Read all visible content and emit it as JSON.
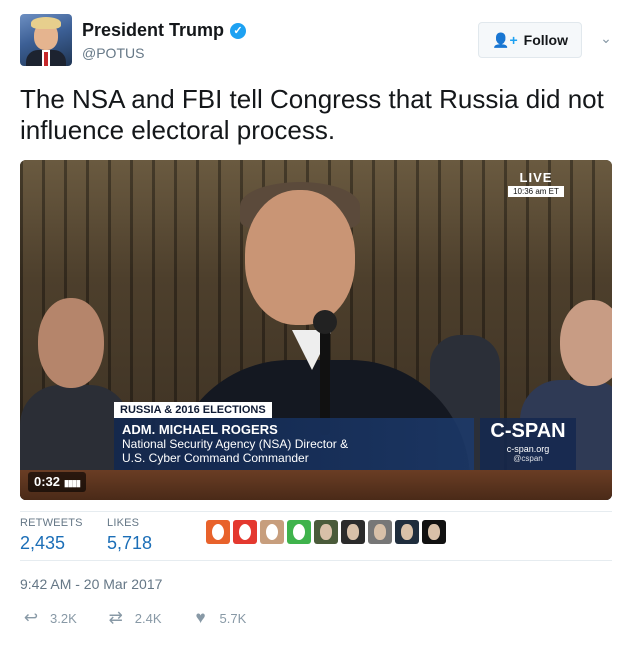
{
  "user": {
    "name": "President Trump",
    "handle": "@POTUS",
    "verified": true
  },
  "follow_button": {
    "label": "Follow",
    "icon": "add-user-icon"
  },
  "menu_icon": "chevron-down-icon",
  "tweet": {
    "text": "The NSA and FBI tell Congress that Russia did not influence electoral process."
  },
  "video": {
    "live_label": "LIVE",
    "live_time": "10:36 am ET",
    "chyron_tag": "RUSSIA & 2016 ELECTIONS",
    "chyron_name": "ADM. MICHAEL ROGERS",
    "chyron_title_1": "National Security Agency (NSA) Director &",
    "chyron_title_2": "U.S. Cyber Command Commander",
    "network_logo": "C-SPAN",
    "network_site": "c-span.org",
    "network_twitter": "@cspan",
    "timecode": "0:32"
  },
  "stats": {
    "retweets_label": "RETWEETS",
    "retweets_value": "2,435",
    "likes_label": "LIKES",
    "likes_value": "5,718"
  },
  "likers": [
    {
      "color": "#e8622b"
    },
    {
      "color": "#e4392f"
    },
    {
      "color": "#c79e7d"
    },
    {
      "color": "#3fb34c"
    },
    {
      "color": "#4a5b3a"
    },
    {
      "color": "#2b2b2b"
    },
    {
      "color": "#777777"
    },
    {
      "color": "#1f2d3d"
    },
    {
      "color": "#111111"
    }
  ],
  "timestamp": "9:42 AM - 20 Mar 2017",
  "actions": {
    "reply_count": "3.2K",
    "retweet_count": "2.4K",
    "like_count": "5.7K"
  },
  "colors": {
    "accent": "#1da1f2",
    "stat_value": "#1b6eb7",
    "muted": "#657786"
  }
}
